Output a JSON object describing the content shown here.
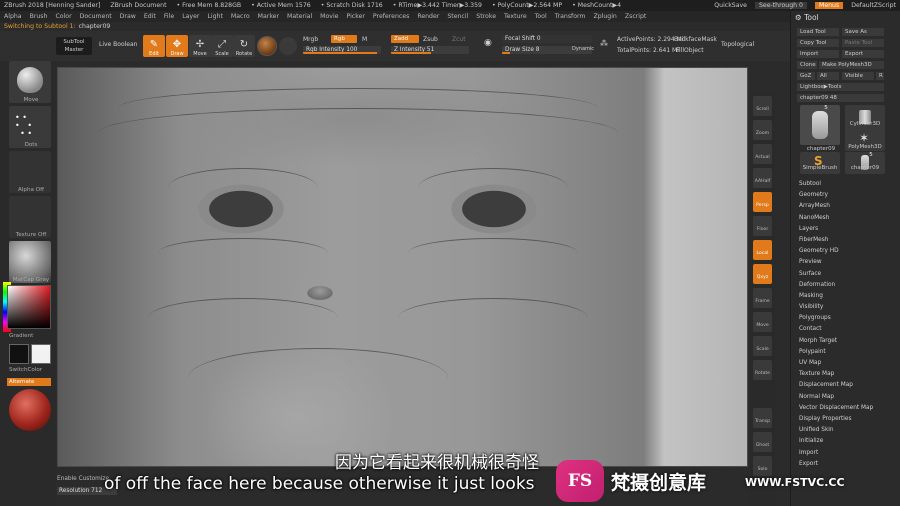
{
  "titlebar": {
    "app": "ZBrush 2018 [Henning Sander]",
    "doc": "ZBrush Document",
    "free_mem": "• Free Mem 8.828GB",
    "active_mem": "• Active Mem 1576",
    "scratch": "• Scratch Disk 1716",
    "rtime": "• RTime▶3.442 Timer▶3.359",
    "polycount": "• PolyCount▶2.564 MP",
    "meshcount": "• MeshCount▶4",
    "quicksave": "QuickSave",
    "see_through": "See-through 0",
    "menus": "Menus",
    "default_script": "DefaultZScript"
  },
  "menu": [
    "Alpha",
    "Brush",
    "Color",
    "Document",
    "Draw",
    "Edit",
    "File",
    "Layer",
    "Light",
    "Macro",
    "Marker",
    "Material",
    "Movie",
    "Picker",
    "Preferences",
    "Render",
    "Stencil",
    "Stroke",
    "Texture",
    "Tool",
    "Transform",
    "Zplugin",
    "Zscript"
  ],
  "subtool_line": {
    "label": "Switching to Subtool 1:",
    "name": "chapter09"
  },
  "toolbar": {
    "subtool_master": "SubTool Master",
    "live_boolean": "Live Boolean",
    "edit": "Edit",
    "draw": "Draw",
    "move": "Move",
    "scale": "Scale",
    "rotate": "Rotate",
    "mrgb": "Mrgb",
    "rgb": "Rgb",
    "m": "M",
    "rgb_intensity": "Rgb Intensity 100",
    "zadd": "Zadd",
    "zsub": "Zsub",
    "zcut": "Zcut",
    "z_intensity": "Z Intensity 51",
    "focal_shift": "Focal Shift 0",
    "draw_size": "Draw Size 8",
    "dynamic": "Dynamic",
    "active_points": "ActivePoints: 2.294 Mil",
    "backface_mask": "BackfaceMask",
    "total_points": "TotalPoints: 2.641 Mil",
    "fill_object": "FillObject",
    "topological": "Topological"
  },
  "lefttray": {
    "move": "Move",
    "dots": "Dots",
    "alpha_off": "Alpha Off",
    "texture_off": "Texture Off",
    "matcap_gray": "MatCap Gray",
    "gradient": "Gradient",
    "switch_color": "SwitchColor",
    "alternate": "Alternate"
  },
  "rightshelf": [
    "Scroll",
    "Zoom",
    "Actual",
    "AAHalf",
    "Persp",
    "Floor",
    "Local",
    "",
    "Frame",
    "Move",
    "Scale",
    "Rotate",
    "",
    "Transp",
    "Ghost",
    "Solo"
  ],
  "rightshelf_xyz": "Qxyz",
  "toolpanel": {
    "header": "Tool",
    "load_tool": "Load Tool",
    "save_as": "Save As",
    "copy_tool": "Copy Tool",
    "paste_tool": "Paste Tool",
    "import": "Import",
    "export": "Export",
    "clone": "Clone",
    "make_polymesh": "Make PolyMesh3D",
    "goz": "GoZ",
    "all": "All",
    "visible": "Visible",
    "r": "R",
    "lightbox": "Lightbox▶Tools",
    "tool_name": "chapter09",
    "tool_count": "48",
    "thumb_labels": [
      "chapter09",
      "Cylinder3D",
      "SimpleBrush",
      "PolyMesh3D",
      "chapter09"
    ],
    "thumb_badge": "5",
    "sections": [
      "Subtool",
      "Geometry",
      "ArrayMesh",
      "NanoMesh",
      "Layers",
      "FiberMesh",
      "Geometry HD",
      "Preview",
      "Surface",
      "Deformation",
      "Masking",
      "Visibility",
      "Polygroups",
      "Contact",
      "Morph Target",
      "Polypaint",
      "UV Map",
      "Texture Map",
      "Displacement Map",
      "Normal Map",
      "Vector Displacement Map",
      "Display Properties",
      "Unified Skin",
      "Initialize",
      "Import",
      "Export"
    ]
  },
  "bottom": {
    "enable_customize": "Enable Customize",
    "resolution": "Resolution 712"
  },
  "subtitles": {
    "cn": "因为它看起来很机械很奇怪",
    "en": "of off the face here because otherwise it just looks"
  },
  "watermark": {
    "logo": "FS",
    "cn": "梵摄创意库",
    "url": "WWW.FSTVC.CC"
  },
  "colors": {
    "accent": "#e07a1b",
    "panel": "#2b2b2b",
    "bar": "#1e1e1e"
  }
}
